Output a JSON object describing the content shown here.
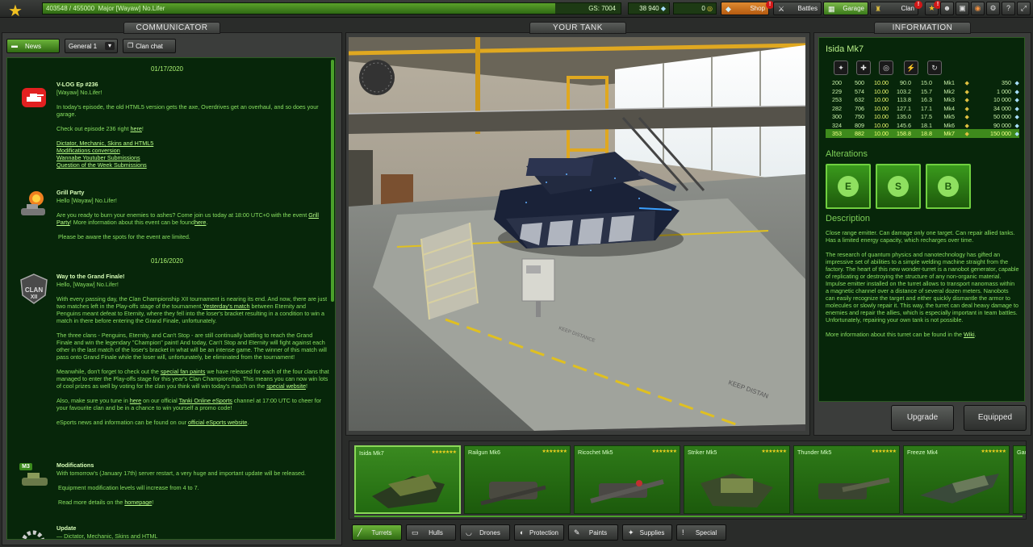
{
  "topbar": {
    "xp_text": "403548 / 455000",
    "rank_name": "Major [Wayaw] No.Lifer",
    "gs": "GS: 7004",
    "xp_progress": 0.887,
    "crystals": "38 940",
    "tankoins": "0",
    "shop_label": "Shop",
    "battles_label": "Battles",
    "garage_label": "Garage",
    "clan_label": "Clan",
    "shop_badge": "!",
    "clan_badge": "!",
    "misc_badge": "!"
  },
  "communicator": {
    "header": "COMMUNICATOR",
    "news_button": "News",
    "channel": "General 1",
    "clan_chat_button": "Clan chat",
    "dates": [
      "01/17/2020",
      "01/16/2020"
    ],
    "news": [
      {
        "title": "V-LOG Ep #236",
        "greeting": "[Wayaw] No.Lifer!",
        "body1": "In today's episode, the old HTML5 version gets the axe, Overdrives get an overhaul, and so does your garage.",
        "body2_pre": "Check out episode 236 right ",
        "body2_link": "here",
        "body2_post": "!",
        "links": [
          "Dictator, Mechanic, Skins and HTML5",
          "Modifications conversion",
          "Wannabe Youtuber Submissions",
          "Question of the Week Submissions"
        ]
      },
      {
        "title": "Grill Party",
        "greeting": "Hello [Wayaw] No.Lifer!",
        "body1_pre": "Are you ready to burn your enemies to ashes? Come join us today at 18:00 UTC+0 with the event ",
        "body1_link1": "Grill Party",
        "body1_mid": "! More information about this event can be found",
        "body1_link2": "here",
        "body1_post": ".",
        "body2": "Please be aware the spots for the event are limited."
      },
      {
        "title": "Way to the Grand Finale!",
        "greeting": "Hello, [Wayaw] No.Lifer!",
        "icon_text": "CLAN",
        "icon_sub": "XII",
        "p1_pre": "With every passing day, the Clan Championship XII tournament is nearing its end. And now, there are just two matches left in the Play-offs stage of the tournament.",
        "p1_link": "Yesterday's match",
        "p1_post": " between Eternity and Penguins meant defeat to Eternity, where they fell into the loser's bracket resulting in a condition to win a match in there before entering the Grand Finale, unfortunately.",
        "p2": "The three clans - Penguins, Eternity, and Can't Stop - are still continually battling to reach the Grand Finale and win the legendary \"Champion\" paint! And today, Can't Stop and Eternity will fight against each other in the last match of the loser's bracket in what will be an intense game. The winner of this match will pass onto Grand Finale while the loser will, unfortunately, be eliminated from the tournament!",
        "p3_pre": "Meanwhile, don't forget to check out the ",
        "p3_link1": "special fan paints",
        "p3_mid": " we have released for each of the four clans that managed to enter the Play-offs stage for this year's Clan Championship. This means you can now win lots of cool prizes as well by voting for the clan you think will win today's match on the ",
        "p3_link2": "special website",
        "p3_post": "!",
        "p4_pre": "Also, make sure you tune in ",
        "p4_link1": "here",
        "p4_mid": " on our official ",
        "p4_link2": "Tanki Online eSports",
        "p4_post": " channel at 17:00 UTC to cheer for your favourite clan and be in a chance to win yourself a promo code!",
        "p5_pre": "eSports news and information can be found on our ",
        "p5_link": "official eSports website",
        "p5_post": "."
      },
      {
        "title": "Modifications",
        "icon_text": "M3",
        "p1": "With tomorrow's (January 17th) server restart, a very huge and important update will be released.",
        "p2": "Equipment modification levels will increase from 4 to 7.",
        "p3_pre": "Read more details on the ",
        "p3_link": "homepage",
        "p3_post": "!"
      },
      {
        "title": "Update",
        "p1": "— Dictator, Mechanic, Skins and HTML"
      }
    ]
  },
  "your_tank": {
    "header": "YOUR TANK",
    "floor_text_1": "KEEP DISTANCE",
    "floor_text_2": "KEEP DISTAN"
  },
  "information": {
    "header": "INFORMATION",
    "item_name": "Isida Mk7",
    "stats": [
      {
        "a": "200",
        "b": "500",
        "c": "10.00",
        "d": "90.0",
        "e": "15.0",
        "mk": "Mk1",
        "price": "350"
      },
      {
        "a": "229",
        "b": "574",
        "c": "10.00",
        "d": "103.2",
        "e": "15.7",
        "mk": "Mk2",
        "price": "1 000"
      },
      {
        "a": "253",
        "b": "632",
        "c": "10.00",
        "d": "113.8",
        "e": "16.3",
        "mk": "Mk3",
        "price": "10 000"
      },
      {
        "a": "282",
        "b": "706",
        "c": "10.00",
        "d": "127.1",
        "e": "17.1",
        "mk": "Mk4",
        "price": "34 000"
      },
      {
        "a": "300",
        "b": "750",
        "c": "10.00",
        "d": "135.0",
        "e": "17.5",
        "mk": "Mk5",
        "price": "50 000"
      },
      {
        "a": "324",
        "b": "809",
        "c": "10.00",
        "d": "145.6",
        "e": "18.1",
        "mk": "Mk6",
        "price": "90 000"
      },
      {
        "a": "353",
        "b": "882",
        "c": "10.00",
        "d": "158.8",
        "e": "18.8",
        "mk": "Mk7",
        "price": "150 000"
      }
    ],
    "selected_row": 6,
    "alterations_title": "Alterations",
    "alteration_icons": [
      "E",
      "S",
      "B"
    ],
    "description_title": "Description",
    "desc_p1": "Close range emitter. Can damage only one target. Can repair allied tanks. Has a limited energy capacity, which recharges over time.",
    "desc_p2": "The research of quantum physics and nanotechnology has gifted an impressive set of abilities to a simple welding machine straight from the factory. The heart of this new wonder-turret is a nanobot generator, capable of replicating or destroying the structure of any non-organic material. Impulse emitter installed on the turret allows to transport nanomass within a magnetic channel over a distance of several dozen meters. Nanobots can easily recognize the target and either quickly dismantle the armor to molecules or slowly repair it. This way, the turret can deal heavy damage to enemies and repair the allies, which is especially important in team battles. Unfortunately, repairing your own tank is not possible.",
    "desc_p3_pre": "More information about this turret can be found in the ",
    "desc_p3_link": "Wiki",
    "desc_p3_post": ".",
    "upgrade_button": "Upgrade",
    "equipped_button": "Equipped"
  },
  "garage": {
    "items": [
      {
        "name": "Isida Mk7",
        "stars": "★★★★★★★"
      },
      {
        "name": "Railgun Mk6",
        "stars": "★★★★★★★"
      },
      {
        "name": "Ricochet Mk5",
        "stars": "★★★★★★★"
      },
      {
        "name": "Striker Mk5",
        "stars": "★★★★★★★"
      },
      {
        "name": "Thunder Mk5",
        "stars": "★★★★★★★"
      },
      {
        "name": "Freeze Mk4",
        "stars": "★★★★★★★"
      },
      {
        "name": "Gaus",
        "stars": ""
      }
    ],
    "categories": [
      "Turrets",
      "Hulls",
      "Drones",
      "Protection",
      "Paints",
      "Supplies",
      "Special"
    ]
  },
  "colors": {
    "accent": "#4aa02a",
    "panel_bg": "#07260a",
    "link": "#b8ff88",
    "selected_row": "#3e8a1c"
  }
}
